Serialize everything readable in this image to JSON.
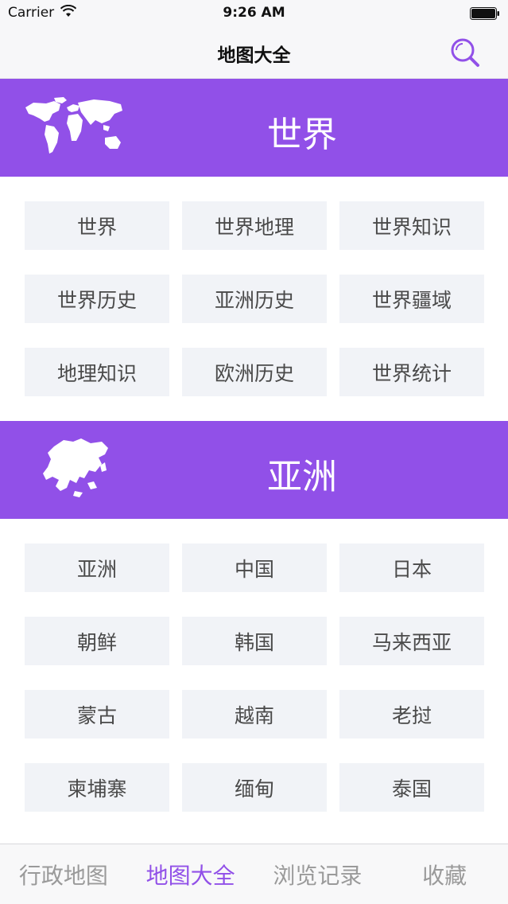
{
  "status_bar": {
    "carrier": "Carrier",
    "time": "9:26 AM"
  },
  "nav": {
    "title": "地图大全",
    "search_icon": "search-icon",
    "accent_color": "#9150e8"
  },
  "sections": [
    {
      "title": "世界",
      "icon": "world-map-icon",
      "items": [
        "世界",
        "世界地理",
        "世界知识",
        "世界历史",
        "亚洲历史",
        "世界疆域",
        "地理知识",
        "欧洲历史",
        "世界统计"
      ]
    },
    {
      "title": "亚洲",
      "icon": "asia-map-icon",
      "items": [
        "亚洲",
        "中国",
        "日本",
        "朝鲜",
        "韩国",
        "马来西亚",
        "蒙古",
        "越南",
        "老挝",
        "柬埔寨",
        "缅甸",
        "泰国"
      ]
    }
  ],
  "tab_bar": {
    "tabs": [
      "行政地图",
      "地图大全",
      "浏览记录",
      "收藏"
    ],
    "active": "地图大全"
  }
}
